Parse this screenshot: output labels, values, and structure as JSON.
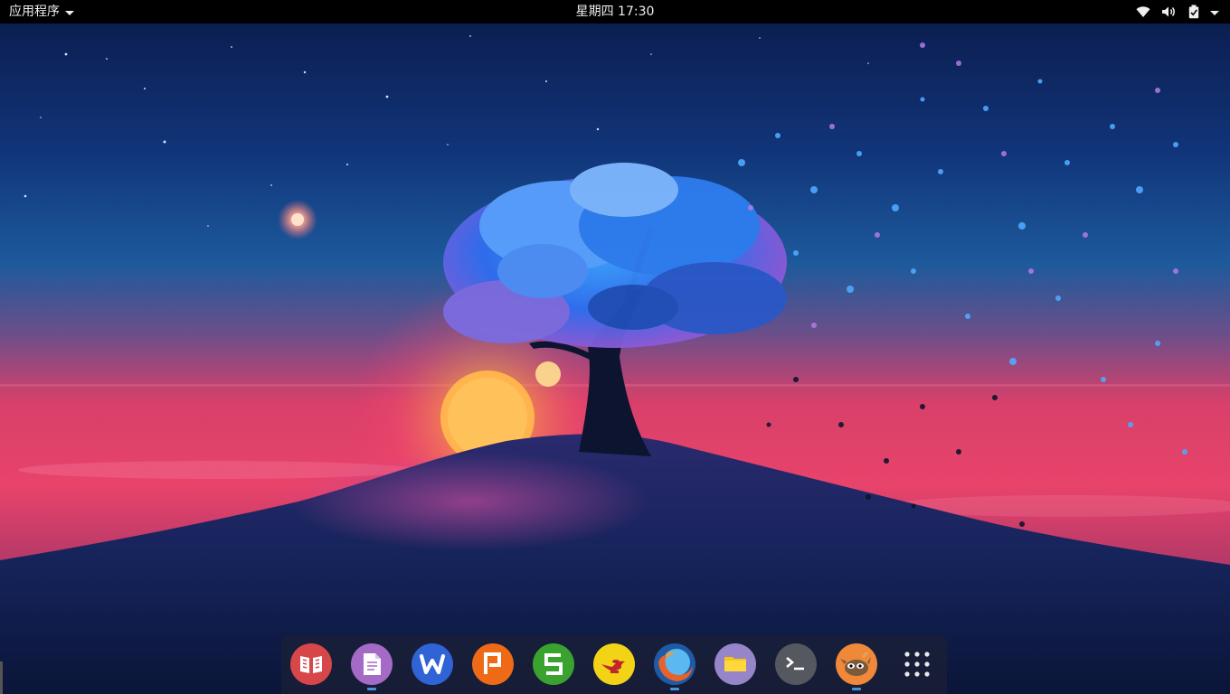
{
  "topbar": {
    "apps_menu_label": "应用程序",
    "clock": "星期四 17:30"
  },
  "status_icons": [
    "wifi-icon",
    "volume-icon",
    "battery-icon",
    "system-menu-caret-icon"
  ],
  "dock": {
    "items": [
      {
        "name": "book-reader",
        "icon": "book-icon",
        "color": "#d7474a",
        "running": false
      },
      {
        "name": "text-editor",
        "icon": "document-icon",
        "color": "#a56ac6",
        "running": true
      },
      {
        "name": "wps-writer",
        "icon": "writer-icon",
        "color": "#2f63d6",
        "running": false
      },
      {
        "name": "wps-presentation",
        "icon": "presentation-icon",
        "color": "#ef6a17",
        "running": false
      },
      {
        "name": "wps-spreadsheet",
        "icon": "spreadsheet-icon",
        "color": "#3aa22e",
        "running": false
      },
      {
        "name": "genie",
        "icon": "magic-lamp-icon",
        "color": "#f2d316",
        "running": false
      },
      {
        "name": "firefox",
        "icon": "firefox-icon",
        "color": "#2c6fb0",
        "running": true
      },
      {
        "name": "files",
        "icon": "folder-icon",
        "color": "#9685c9",
        "running": false
      },
      {
        "name": "terminal",
        "icon": "terminal-icon",
        "color": "#55585e",
        "running": false
      },
      {
        "name": "gimp",
        "icon": "gimp-icon",
        "color": "#f0883a",
        "running": true
      },
      {
        "name": "show-applications",
        "icon": "app-grid-icon",
        "color": "#ffffff",
        "running": false
      }
    ]
  },
  "colors": {
    "topbar_bg": "#000000",
    "running_indicator": "#4a90d9",
    "sky_top": "#0c1f4e",
    "sky_horizon": "#e8436b"
  }
}
